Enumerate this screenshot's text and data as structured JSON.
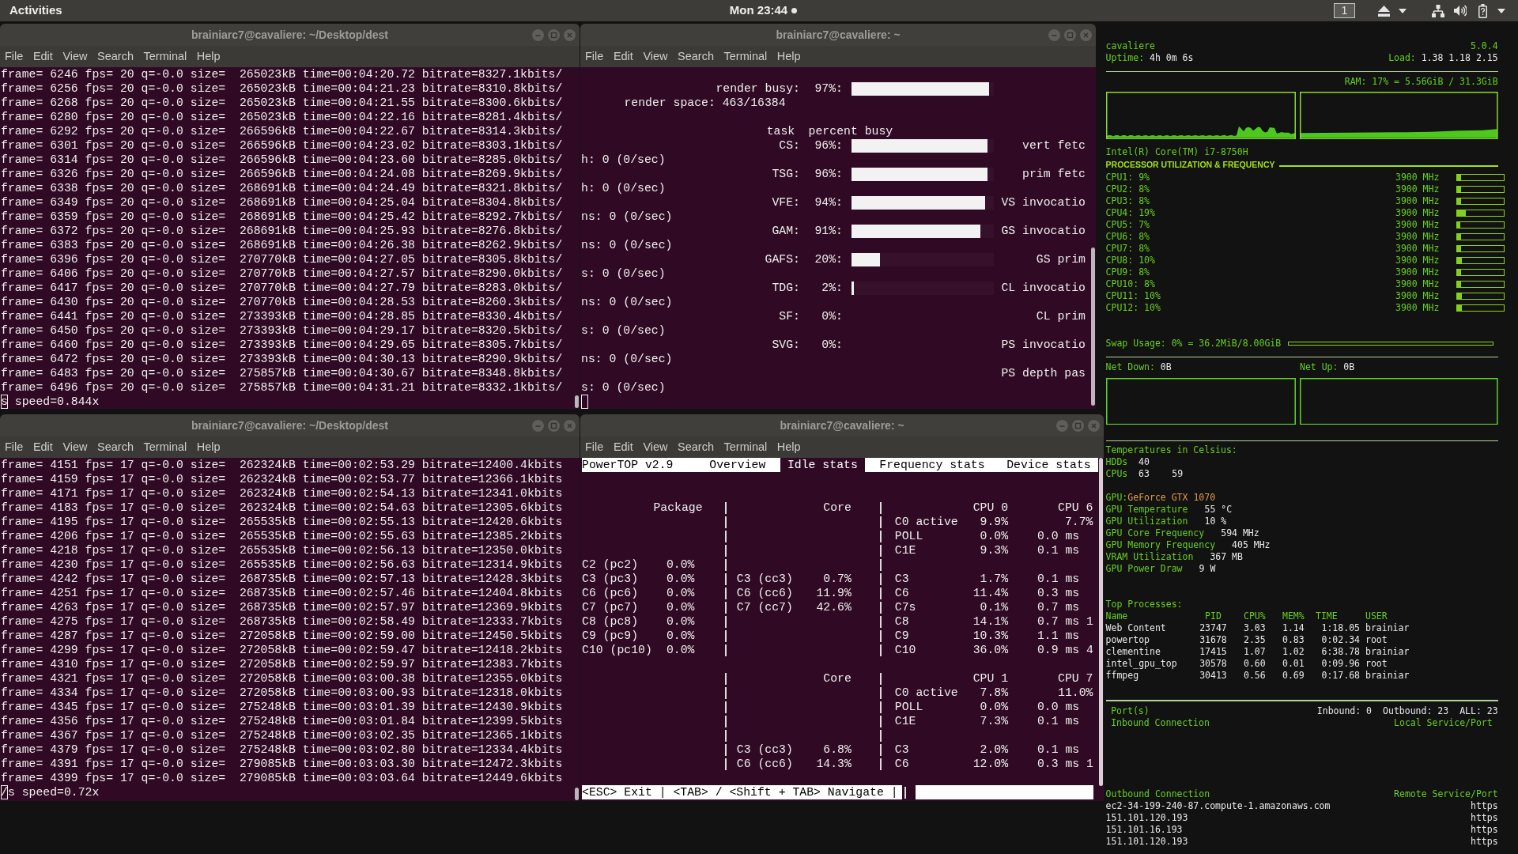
{
  "top_bar": {
    "activities": "Activities",
    "clock": "Mon 23:44",
    "notification": true,
    "workspace": "1"
  },
  "windows": [
    {
      "kind": "ffmpeg",
      "title": "brainiarc7@cavaliere: ~/Desktop/dest",
      "focused": false,
      "menu": [
        "File",
        "Edit",
        "View",
        "Search",
        "Terminal",
        "Help"
      ],
      "lines": [
        "frame= 6246 fps= 20 q=-0.0 size=  265023kB time=00:04:20.72 bitrate=8327.1kbits/",
        "frame= 6256 fps= 20 q=-0.0 size=  265023kB time=00:04:21.23 bitrate=8310.8kbits/",
        "frame= 6268 fps= 20 q=-0.0 size=  265023kB time=00:04:21.55 bitrate=8300.6kbits/",
        "frame= 6280 fps= 20 q=-0.0 size=  265023kB time=00:04:22.16 bitrate=8281.4kbits/",
        "frame= 6292 fps= 20 q=-0.0 size=  266596kB time=00:04:22.67 bitrate=8314.3kbits/",
        "frame= 6301 fps= 20 q=-0.0 size=  266596kB time=00:04:23.02 bitrate=8303.1kbits/",
        "frame= 6314 fps= 20 q=-0.0 size=  266596kB time=00:04:23.60 bitrate=8285.0kbits/",
        "frame= 6326 fps= 20 q=-0.0 size=  266596kB time=00:04:24.08 bitrate=8269.9kbits/",
        "frame= 6338 fps= 20 q=-0.0 size=  268691kB time=00:04:24.49 bitrate=8321.8kbits/",
        "frame= 6349 fps= 20 q=-0.0 size=  268691kB time=00:04:25.04 bitrate=8304.8kbits/",
        "frame= 6359 fps= 20 q=-0.0 size=  268691kB time=00:04:25.42 bitrate=8292.7kbits/",
        "frame= 6372 fps= 20 q=-0.0 size=  268691kB time=00:04:25.93 bitrate=8276.8kbits/",
        "frame= 6383 fps= 20 q=-0.0 size=  268691kB time=00:04:26.38 bitrate=8262.9kbits/",
        "frame= 6396 fps= 20 q=-0.0 size=  270770kB time=00:04:27.05 bitrate=8305.8kbits/",
        "frame= 6406 fps= 20 q=-0.0 size=  270770kB time=00:04:27.57 bitrate=8290.0kbits/",
        "frame= 6417 fps= 20 q=-0.0 size=  270770kB time=00:04:27.79 bitrate=8283.0kbits/",
        "frame= 6430 fps= 20 q=-0.0 size=  270770kB time=00:04:28.53 bitrate=8260.3kbits/",
        "frame= 6441 fps= 20 q=-0.0 size=  273393kB time=00:04:28.85 bitrate=8330.4kbits/",
        "frame= 6450 fps= 20 q=-0.0 size=  273393kB time=00:04:29.17 bitrate=8320.5kbits/",
        "frame= 6460 fps= 20 q=-0.0 size=  273393kB time=00:04:29.65 bitrate=8305.7kbits/",
        "frame= 6472 fps= 20 q=-0.0 size=  273393kB time=00:04:30.13 bitrate=8290.9kbits/",
        "frame= 6483 fps= 20 q=-0.0 size=  275857kB time=00:04:30.67 bitrate=8348.8kbits/",
        "frame= 6496 fps= 20 q=-0.0 size=  275857kB time=00:04:31.21 bitrate=8332.1kbits/",
        "s speed=0.844x"
      ]
    },
    {
      "kind": "gpu_top",
      "title": "brainiarc7@cavaliere: ~",
      "focused": false,
      "menu": [
        "File",
        "Edit",
        "View",
        "Search",
        "Terminal",
        "Help"
      ],
      "render_busy": {
        "label": "render busy:",
        "percent": "97%:",
        "level": 0.97
      },
      "render_space": "render space: 463/16384",
      "header": {
        "task": "task",
        "percent": "percent busy"
      },
      "rows": [
        {
          "task": "CS:",
          "percent": "96%:",
          "level": 0.96,
          "counter": "vert fetc",
          "wrap": "h: 0 (0/sec)"
        },
        {
          "task": "TSG:",
          "percent": "96%:",
          "level": 0.96,
          "counter": "prim fetc",
          "wrap": "h: 0 (0/sec)"
        },
        {
          "task": "VFE:",
          "percent": "94%:",
          "level": 0.94,
          "counter": "VS invocatio",
          "wrap": "ns: 0 (0/sec)"
        },
        {
          "task": "GAM:",
          "percent": "91%:",
          "level": 0.91,
          "counter": "GS invocatio",
          "wrap": "ns: 0 (0/sec)"
        },
        {
          "task": "GAFS:",
          "percent": "20%:",
          "level": 0.2,
          "counter": "GS prim",
          "wrap": "s: 0 (0/sec)"
        },
        {
          "task": "TDG:",
          "percent": "2%:",
          "level": 0.02,
          "counter": "CL invocatio",
          "wrap": "ns: 0 (0/sec)"
        },
        {
          "task": "SF:",
          "percent": "0%:",
          "counter": "CL prim",
          "wrap": "s: 0 (0/sec)"
        },
        {
          "task": "SVG:",
          "percent": "0%:",
          "counter": "PS invocatio",
          "wrap": "ns: 0 (0/sec)"
        },
        {
          "counter": "PS depth pas",
          "wrap": "s: 0 (0/sec)"
        }
      ]
    },
    {
      "kind": "ffmpeg",
      "title": "brainiarc7@cavaliere: ~/Desktop/dest",
      "focused": false,
      "menu": [
        "File",
        "Edit",
        "View",
        "Search",
        "Terminal",
        "Help"
      ],
      "lines": [
        "frame= 4151 fps= 17 q=-0.0 size=  262324kB time=00:02:53.29 bitrate=12400.4kbits",
        "frame= 4159 fps= 17 q=-0.0 size=  262324kB time=00:02:53.77 bitrate=12366.1kbits",
        "frame= 4171 fps= 17 q=-0.0 size=  262324kB time=00:02:54.13 bitrate=12341.0kbits",
        "frame= 4183 fps= 17 q=-0.0 size=  262324kB time=00:02:54.63 bitrate=12305.6kbits",
        "frame= 4195 fps= 17 q=-0.0 size=  265535kB time=00:02:55.13 bitrate=12420.6kbits",
        "frame= 4206 fps= 17 q=-0.0 size=  265535kB time=00:02:55.63 bitrate=12385.2kbits",
        "frame= 4218 fps= 17 q=-0.0 size=  265535kB time=00:02:56.13 bitrate=12350.0kbits",
        "frame= 4230 fps= 17 q=-0.0 size=  265535kB time=00:02:56.63 bitrate=12314.9kbits",
        "frame= 4242 fps= 17 q=-0.0 size=  268735kB time=00:02:57.13 bitrate=12428.3kbits",
        "frame= 4251 fps= 17 q=-0.0 size=  268735kB time=00:02:57.46 bitrate=12404.8kbits",
        "frame= 4263 fps= 17 q=-0.0 size=  268735kB time=00:02:57.97 bitrate=12369.9kbits",
        "frame= 4275 fps= 17 q=-0.0 size=  268735kB time=00:02:58.49 bitrate=12333.7kbits",
        "frame= 4287 fps= 17 q=-0.0 size=  272058kB time=00:02:59.00 bitrate=12450.5kbits",
        "frame= 4299 fps= 17 q=-0.0 size=  272058kB time=00:02:59.47 bitrate=12418.2kbits",
        "frame= 4310 fps= 17 q=-0.0 size=  272058kB time=00:02:59.97 bitrate=12383.7kbits",
        "frame= 4321 fps= 17 q=-0.0 size=  272058kB time=00:03:00.38 bitrate=12355.0kbits",
        "frame= 4334 fps= 17 q=-0.0 size=  272058kB time=00:03:00.93 bitrate=12318.0kbits",
        "frame= 4345 fps= 17 q=-0.0 size=  275248kB time=00:03:01.39 bitrate=12430.9kbits",
        "frame= 4356 fps= 17 q=-0.0 size=  275248kB time=00:03:01.84 bitrate=12399.5kbits",
        "frame= 4367 fps= 17 q=-0.0 size=  275248kB time=00:03:02.35 bitrate=12365.1kbits",
        "frame= 4379 fps= 17 q=-0.0 size=  275248kB time=00:03:02.80 bitrate=12334.4kbits",
        "frame= 4391 fps= 17 q=-0.0 size=  279085kB time=00:03:03.30 bitrate=12472.3kbits",
        "frame= 4399 fps= 17 q=-0.0 size=  279085kB time=00:03:03.64 bitrate=12449.6kbits",
        "/s speed=0.72x"
      ]
    },
    {
      "kind": "powertop",
      "title": "brainiarc7@cavaliere: ~",
      "focused": false,
      "menu": [
        "File",
        "Edit",
        "View",
        "Search",
        "Terminal",
        "Help"
      ],
      "app_title": "PowerTOP v2.9",
      "tabs": [
        {
          "label": "Overview",
          "selected": false
        },
        {
          "label": "Idle stats",
          "selected": true
        },
        {
          "label": "Frequency stats",
          "selected": false
        },
        {
          "label": "Device stats",
          "selected": false
        }
      ],
      "blocks": [
        {
          "rows": [
            {
              "kind": "header",
              "package": "Package",
              "core": "Core",
              "cpu": [
                "CPU 0",
                "CPU 6"
              ]
            },
            {
              "kind": "active",
              "cpu": [
                "C0 active",
                "9.9%",
                "7.7%"
              ]
            },
            {
              "kind": "state",
              "cpu": [
                "POLL",
                "0.0%",
                "0.0 ms"
              ]
            },
            {
              "kind": "state",
              "cpu": [
                "C1E",
                "9.3%",
                "0.1 ms"
              ]
            },
            {
              "kind": "state",
              "package": [
                "C2 (pc2)",
                "0.0%"
              ]
            },
            {
              "kind": "state",
              "package": [
                "C3 (pc3)",
                "0.0%"
              ],
              "core": [
                "C3 (cc3)",
                "0.7%"
              ],
              "cpu": [
                "C3",
                "1.7%",
                "0.1 ms"
              ]
            },
            {
              "kind": "state",
              "package": [
                "C6 (pc6)",
                "0.0%"
              ],
              "core": [
                "C6 (cc6)",
                "11.9%"
              ],
              "cpu": [
                "C6",
                "11.4%",
                "0.3 ms"
              ]
            },
            {
              "kind": "state",
              "package": [
                "C7 (pc7)",
                "0.0%"
              ],
              "core": [
                "C7 (cc7)",
                "42.6%"
              ],
              "cpu": [
                "C7s",
                "0.1%",
                "0.7 ms"
              ]
            },
            {
              "kind": "state",
              "package": [
                "C8 (pc8)",
                "0.0%"
              ],
              "cpu": [
                "C8",
                "14.1%",
                "0.7 ms 1"
              ]
            },
            {
              "kind": "state",
              "package": [
                "C9 (pc9)",
                "0.0%"
              ],
              "cpu": [
                "C9",
                "10.3%",
                "1.1 ms"
              ]
            },
            {
              "kind": "state",
              "package": [
                "C10 (pc10)",
                "0.0%"
              ],
              "cpu": [
                "C10",
                "36.0%",
                "0.9 ms 4"
              ]
            }
          ]
        },
        {
          "rows": [
            {
              "kind": "header",
              "core": "Core",
              "cpu": [
                "CPU 1",
                "CPU 7"
              ]
            },
            {
              "kind": "active",
              "cpu": [
                "C0 active",
                "7.8%",
                "11.0%"
              ]
            },
            {
              "kind": "state",
              "cpu": [
                "POLL",
                "0.0%",
                "0.0 ms"
              ]
            },
            {
              "kind": "state",
              "cpu": [
                "C1E",
                "7.3%",
                "0.1 ms"
              ]
            },
            {
              "kind": "state"
            },
            {
              "kind": "state",
              "core": [
                "C3 (cc3)",
                "6.8%"
              ],
              "cpu": [
                "C3",
                "2.0%",
                "0.1 ms"
              ]
            },
            {
              "kind": "state",
              "core": [
                "C6 (cc6)",
                "14.3%"
              ],
              "cpu": [
                "C6",
                "12.0%",
                "0.3 ms 1"
              ]
            }
          ]
        }
      ],
      "status": "<ESC> Exit | <TAB> / <Shift + TAB> Navigate |"
    }
  ],
  "conky": {
    "host": "cavaliere",
    "version": "5.0.4",
    "uptime": {
      "label": "Uptime:",
      "value": "4h 0m 6s"
    },
    "load": {
      "label": "Load:",
      "value": "1.38 1.18 2.15"
    },
    "ram": "RAM: 17% = 5.56GiB / 31.3GiB",
    "cpu_model": "Intel(R) Core(TM) i7-8750H",
    "cpu_section": "PROCESSOR UTILIZATION & FREQUENCY",
    "cpus": [
      {
        "label": "CPU1: 9%",
        "freq": "3900 MHz",
        "level": 0.09
      },
      {
        "label": "CPU2: 8%",
        "freq": "3900 MHz",
        "level": 0.08
      },
      {
        "label": "CPU3: 8%",
        "freq": "3900 MHz",
        "level": 0.08
      },
      {
        "label": "CPU4: 19%",
        "freq": "3900 MHz",
        "level": 0.19
      },
      {
        "label": "CPU5: 7%",
        "freq": "3900 MHz",
        "level": 0.07
      },
      {
        "label": "CPU6: 8%",
        "freq": "3900 MHz",
        "level": 0.08
      },
      {
        "label": "CPU7: 8%",
        "freq": "3900 MHz",
        "level": 0.08
      },
      {
        "label": "CPU8: 10%",
        "freq": "3900 MHz",
        "level": 0.1
      },
      {
        "label": "CPU9: 8%",
        "freq": "3900 MHz",
        "level": 0.08
      },
      {
        "label": "CPU10: 8%",
        "freq": "3900 MHz",
        "level": 0.08
      },
      {
        "label": "CPU11: 10%",
        "freq": "3900 MHz",
        "level": 0.1
      },
      {
        "label": "CPU12: 10%",
        "freq": "3900 MHz",
        "level": 0.1
      }
    ],
    "swap": "Swap Usage: 0% = 36.2MiB/8.00GiB",
    "net_down": {
      "label": "Net Down:",
      "value": "0B"
    },
    "net_up": {
      "label": "Net Up:",
      "value": "0B"
    },
    "temps": {
      "title": "Temperatures in Celsius:",
      "rows": [
        {
          "label": "HDDs",
          "values": [
            "40"
          ]
        },
        {
          "label": "CPUs",
          "values": [
            "63",
            "59"
          ]
        }
      ]
    },
    "gpu": {
      "label": "GPU:",
      "name": "GeForce GTX 1070",
      "stats": [
        {
          "label": "GPU Temperature",
          "value": "55 °C"
        },
        {
          "label": "GPU Utilization",
          "value": "10 %"
        },
        {
          "label": "GPU Core Frequency",
          "value": "594 MHz"
        },
        {
          "label": "GPU Memory Frequency",
          "value": "405 MHz"
        },
        {
          "label": "VRAM Utilization",
          "value": "367 MB"
        },
        {
          "label": "GPU Power Draw",
          "value": "9 W"
        }
      ]
    },
    "processes": {
      "title": "Top Processes:",
      "columns": [
        "Name",
        "PID",
        "CPU%",
        "MEM%",
        "TIME",
        "USER"
      ],
      "rows": [
        [
          "Web Content",
          "23747",
          "3.03",
          "1.14",
          "1:18.05",
          "brainiar"
        ],
        [
          "powertop",
          "31678",
          "2.35",
          "0.83",
          "0:02.34",
          "root"
        ],
        [
          "clementine",
          "17415",
          "1.07",
          "1.02",
          "6:38.78",
          "brainiar"
        ],
        [
          "intel_gpu_top",
          "30578",
          "0.60",
          "0.01",
          "0:09.96",
          "root"
        ],
        [
          "ffmpeg",
          "30413",
          "0.56",
          "0.69",
          "0:17.68",
          "brainiar"
        ]
      ]
    },
    "ports": {
      "title": "Port(s)",
      "counts": [
        "Inbound: 0",
        "Outbound: 23",
        "ALL: 23"
      ],
      "inbound_header": [
        "Inbound Connection",
        "Local Service/Port"
      ],
      "outbound_header": [
        "Outbound Connection",
        "Remote Service/Port"
      ],
      "outbound_rows": [
        [
          "ec2-34-199-240-87.compute-1.amazonaws.com",
          "https"
        ],
        [
          "151.101.120.193",
          "https"
        ],
        [
          "151.101.16.193",
          "https"
        ],
        [
          "151.101.120.193",
          "https"
        ]
      ]
    }
  }
}
